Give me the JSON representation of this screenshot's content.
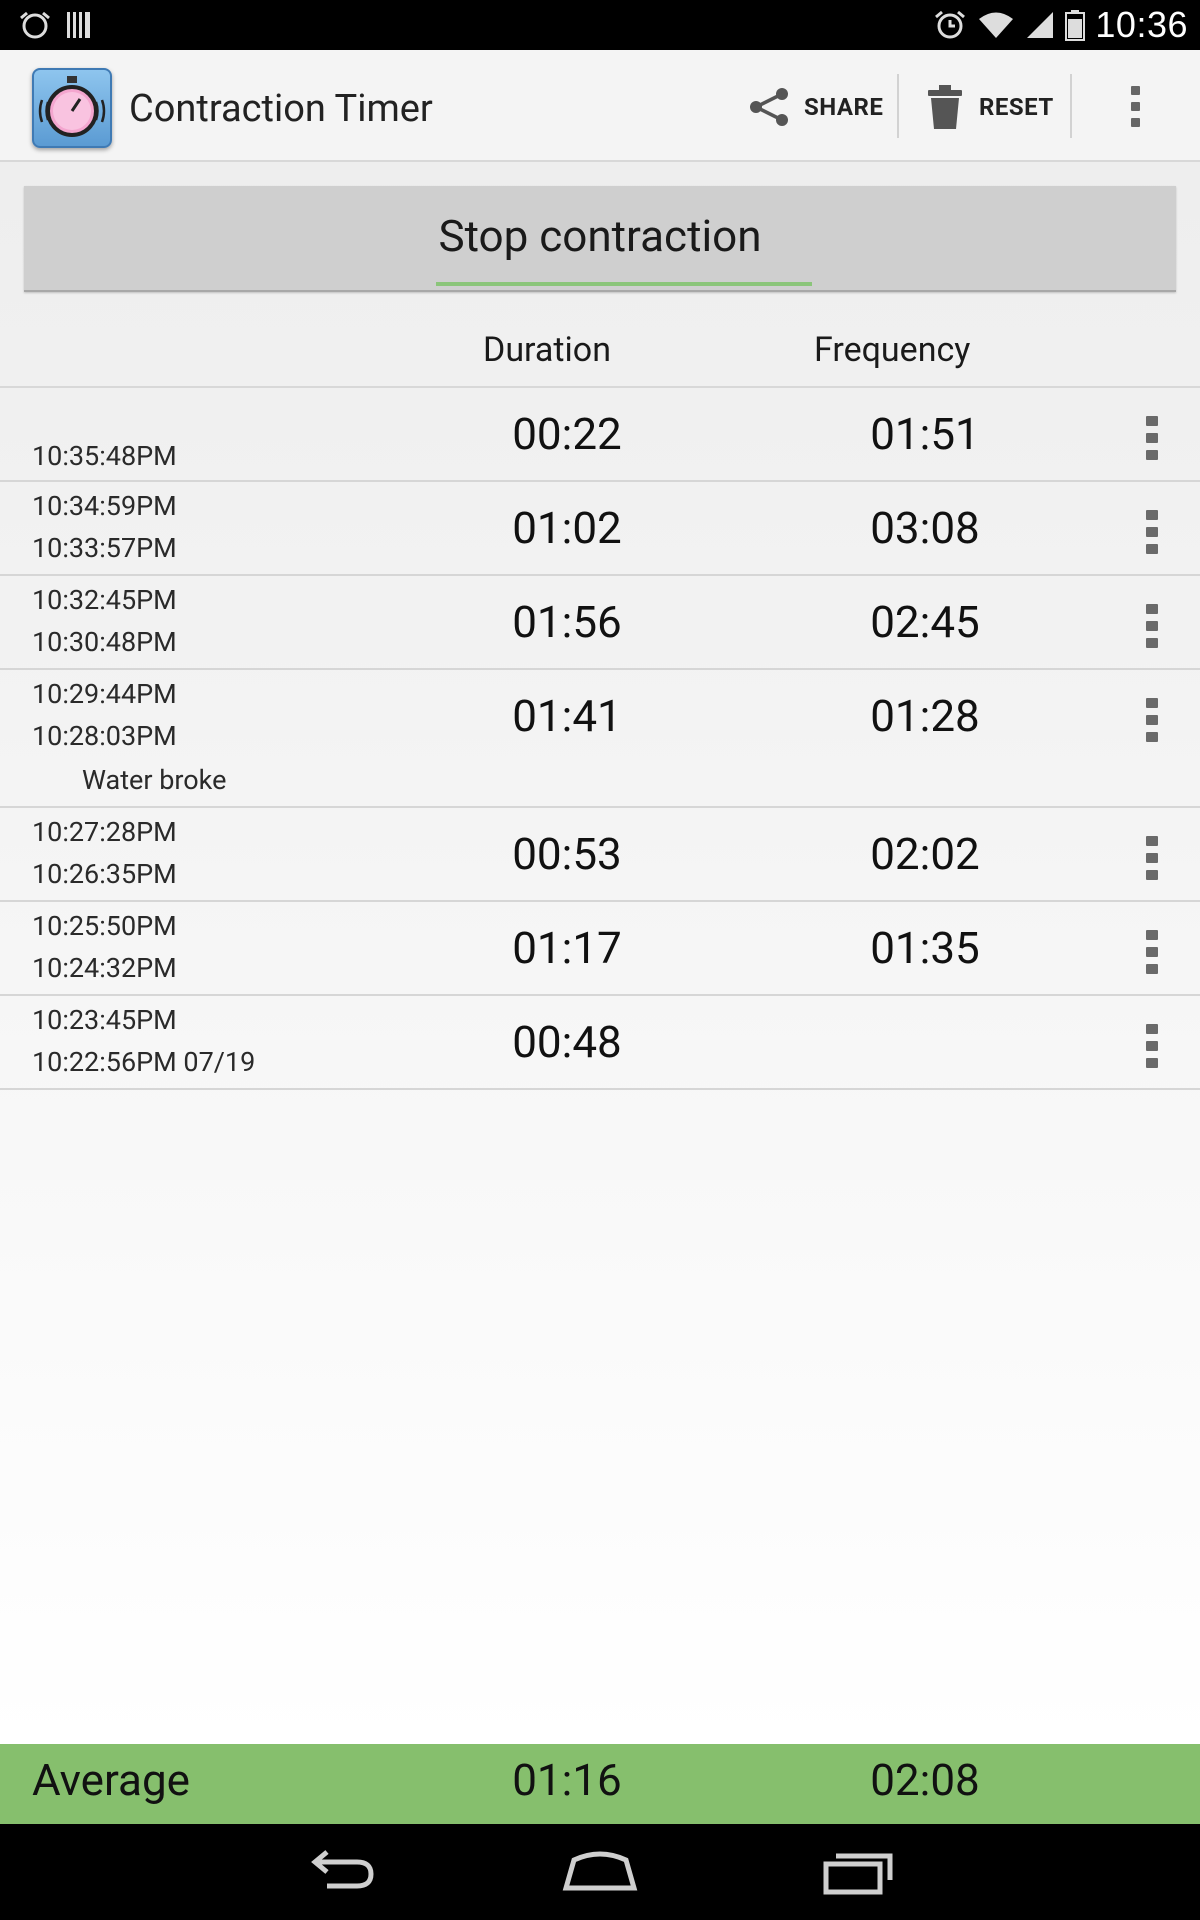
{
  "status_bar": {
    "time": "10:36",
    "left_icons": [
      "alarm-outline-icon",
      "barcode-icon"
    ],
    "right_icons": [
      "alarm-icon",
      "wifi-icon",
      "signal-icon",
      "battery-icon"
    ]
  },
  "action_bar": {
    "title": "Contraction Timer",
    "share_label": "SHARE",
    "reset_label": "RESET"
  },
  "stop_button": {
    "label": "Stop contraction",
    "accent": "#8bc57a"
  },
  "table": {
    "headers": {
      "duration": "Duration",
      "frequency": "Frequency"
    },
    "rows": [
      {
        "start": "",
        "end": "10:35:48PM",
        "duration": "00:22",
        "frequency": "01:51",
        "note": ""
      },
      {
        "start": "10:34:59PM",
        "end": "10:33:57PM",
        "duration": "01:02",
        "frequency": "03:08",
        "note": ""
      },
      {
        "start": "10:32:45PM",
        "end": "10:30:48PM",
        "duration": "01:56",
        "frequency": "02:45",
        "note": ""
      },
      {
        "start": "10:29:44PM",
        "end": "10:28:03PM",
        "duration": "01:41",
        "frequency": "01:28",
        "note": "Water broke"
      },
      {
        "start": "10:27:28PM",
        "end": "10:26:35PM",
        "duration": "00:53",
        "frequency": "02:02",
        "note": ""
      },
      {
        "start": "10:25:50PM",
        "end": "10:24:32PM",
        "duration": "01:17",
        "frequency": "01:35",
        "note": ""
      },
      {
        "start": "10:23:45PM",
        "end": "10:22:56PM 07/19",
        "duration": "00:48",
        "frequency": "",
        "note": ""
      }
    ]
  },
  "average": {
    "label": "Average",
    "duration": "01:16",
    "frequency": "02:08",
    "color": "#86bf6d"
  },
  "nav_bar": {
    "buttons": [
      "back-icon",
      "home-icon",
      "recent-apps-icon"
    ]
  }
}
